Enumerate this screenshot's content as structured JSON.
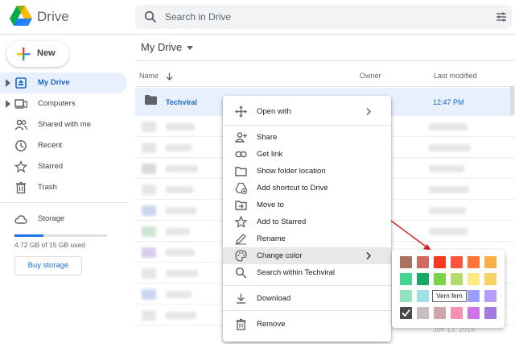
{
  "app": {
    "name": "Drive"
  },
  "search": {
    "placeholder": "Search in Drive"
  },
  "new_button": {
    "label": "New"
  },
  "nav": [
    {
      "label": "My Drive",
      "icon": "my-drive-icon",
      "active": true
    },
    {
      "label": "Computers",
      "icon": "computers-icon",
      "active": false
    },
    {
      "label": "Shared with me",
      "icon": "shared-with-me-icon",
      "active": false
    },
    {
      "label": "Recent",
      "icon": "clock-icon",
      "active": false
    },
    {
      "label": "Starred",
      "icon": "star-icon",
      "active": false
    },
    {
      "label": "Trash",
      "icon": "trash-icon",
      "active": false
    }
  ],
  "storage": {
    "label": "Storage",
    "usage_text": "4.72 GB of 15 GB used",
    "used_fraction": 0.315,
    "buy_label": "Buy storage"
  },
  "main": {
    "breadcrumb": "My Drive",
    "columns": {
      "name": "Name",
      "owner": "Owner",
      "modified": "Last modified"
    },
    "selected_row": {
      "name": "Techviral",
      "modified": "12:47 PM"
    },
    "last_visible_date": "Jun 13, 2019"
  },
  "context_menu": {
    "items": [
      {
        "label": "Open with",
        "icon": "move-arrows-icon",
        "submenu": true,
        "group": 0
      },
      {
        "label": "Share",
        "icon": "person-add-icon",
        "group": 1
      },
      {
        "label": "Get link",
        "icon": "link-icon",
        "group": 1
      },
      {
        "label": "Show folder location",
        "icon": "folder-outline-icon",
        "group": 1
      },
      {
        "label": "Add shortcut to Drive",
        "icon": "add-to-drive-icon",
        "group": 1
      },
      {
        "label": "Move to",
        "icon": "move-to-icon",
        "group": 1
      },
      {
        "label": "Add to Starred",
        "icon": "star-outline-icon",
        "group": 1
      },
      {
        "label": "Rename",
        "icon": "pencil-icon",
        "group": 1
      },
      {
        "label": "Change color",
        "icon": "palette-icon",
        "submenu": true,
        "highlighted": true,
        "group": 1
      },
      {
        "label": "Search within Techviral",
        "icon": "search-icon",
        "group": 1
      },
      {
        "label": "Download",
        "icon": "download-icon",
        "group": 2
      },
      {
        "label": "Remove",
        "icon": "trash-icon",
        "group": 3
      }
    ]
  },
  "color_palette": {
    "tooltip": "Vern fern",
    "colors": [
      [
        "#ac725e",
        "#d06b64",
        "#f83a22",
        "#fa573c",
        "#ff7537",
        "#ffad46"
      ],
      [
        "#42d692",
        "#16a765",
        "#7bd148",
        "#b3dc6c",
        "#fbe983",
        "#fad165"
      ],
      [
        "#92e1c0",
        "#9fe1e7",
        "#9fc6e7",
        "#4986e7",
        "#9a9cff",
        "#b99aff"
      ],
      [
        "#8f8f8f",
        "#cabdbf",
        "#cca6ac",
        "#f691b2",
        "#cd74e6",
        "#a47ae2"
      ]
    ],
    "selected": [
      3,
      0
    ]
  }
}
